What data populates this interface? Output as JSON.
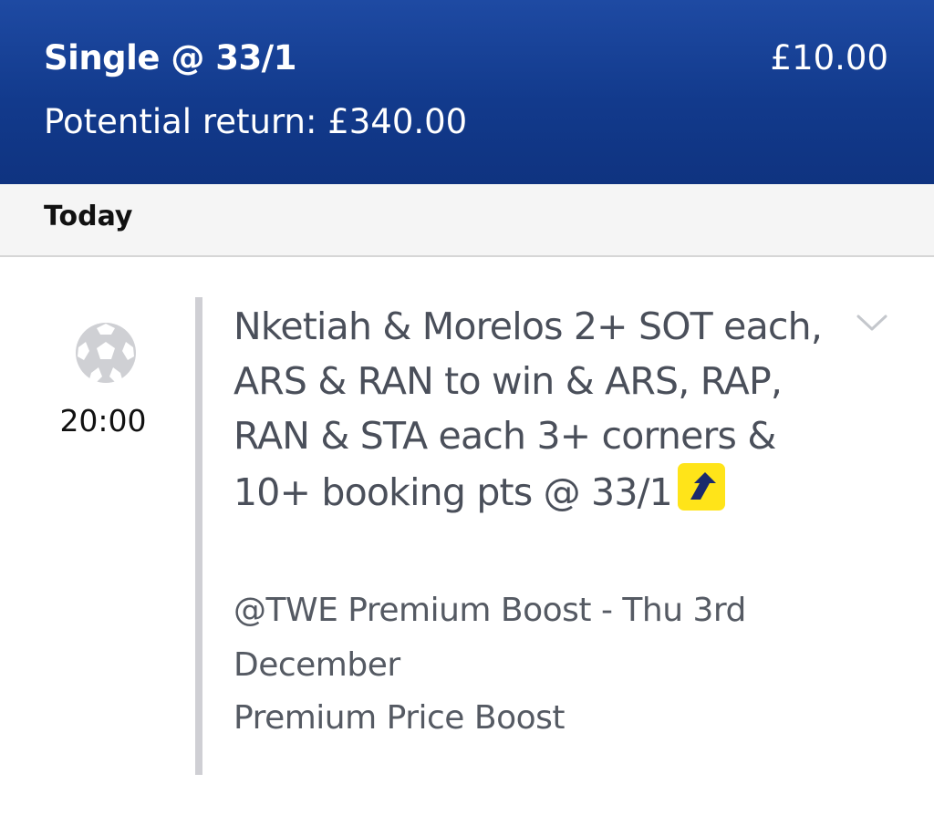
{
  "header": {
    "bet_type": "Single @ 33/1",
    "stake": "£10.00",
    "potential_return": "Potential return: £340.00"
  },
  "date_group": {
    "label": "Today"
  },
  "event": {
    "sport_icon": "football-icon",
    "time": "20:00",
    "selection": "Nketiah & Morelos 2+ SOT each, ARS & RAN to win & ARS, RAP, RAN & STA each 3+ corners & 10+ booking pts @ 33/1",
    "boost_icon": "price-boost-arrow-icon",
    "expand_icon": "chevron-down-icon",
    "market": "@TWE Premium Boost - Thu 3rd December",
    "boost_type": "Premium Price Boost"
  },
  "colors": {
    "header_bg": "#123a8c",
    "boost_badge": "#ffe419",
    "boost_arrow": "#1a2a6c"
  }
}
